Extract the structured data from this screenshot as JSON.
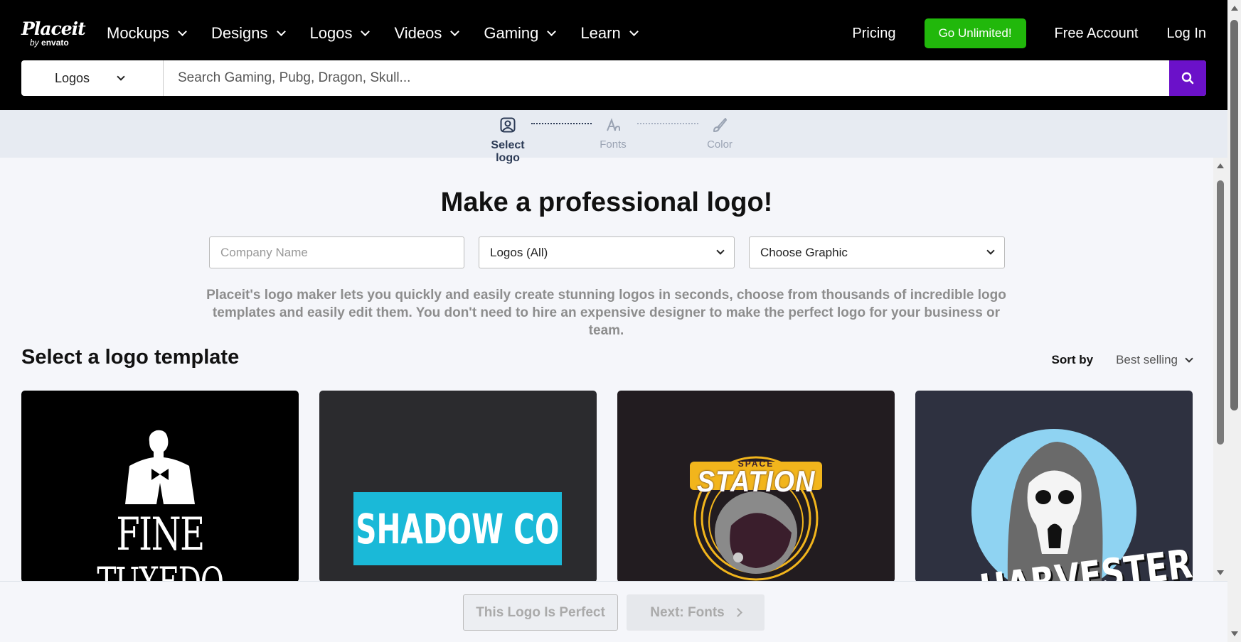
{
  "header": {
    "brand": "Placeit",
    "brand_sub_prefix": "by",
    "brand_sub": "envato",
    "nav": [
      {
        "label": "Mockups"
      },
      {
        "label": "Designs"
      },
      {
        "label": "Logos"
      },
      {
        "label": "Videos"
      },
      {
        "label": "Gaming"
      },
      {
        "label": "Learn"
      }
    ],
    "pricing": "Pricing",
    "unlimited": "Go Unlimited!",
    "free_account": "Free Account",
    "login": "Log In"
  },
  "search": {
    "category": "Logos",
    "placeholder": "Search Gaming, Pubg, Dragon, Skull..."
  },
  "steps": [
    {
      "label": "Select logo",
      "active": true
    },
    {
      "label": "Fonts",
      "active": false
    },
    {
      "label": "Color",
      "active": false
    }
  ],
  "main": {
    "title": "Make a professional logo!",
    "company_placeholder": "Company Name",
    "logos_select": "Logos (All)",
    "graphic_select": "Choose Graphic",
    "description": "Placeit's logo maker lets you quickly and easily create stunning logos in seconds, choose from thousands of incredible logo templates and easily edit them. You don't need to hire an expensive designer to make the perfect logo for your business or team."
  },
  "templates": {
    "title": "Select a logo template",
    "sort_label": "Sort by",
    "sort_value": "Best selling",
    "cards": [
      {
        "text_1": "FINE",
        "text_2": "TUXEDO"
      },
      {
        "text_1": "SHADOW CO"
      },
      {
        "text_1": "SPACE",
        "text_2": "STATION"
      },
      {
        "text_1": "HARVESTER"
      }
    ]
  },
  "bottom": {
    "perfect": "This Logo Is Perfect",
    "next": "Next: Fonts"
  },
  "colors": {
    "accent": "#6b11c9",
    "unlimited": "#21b80b"
  }
}
